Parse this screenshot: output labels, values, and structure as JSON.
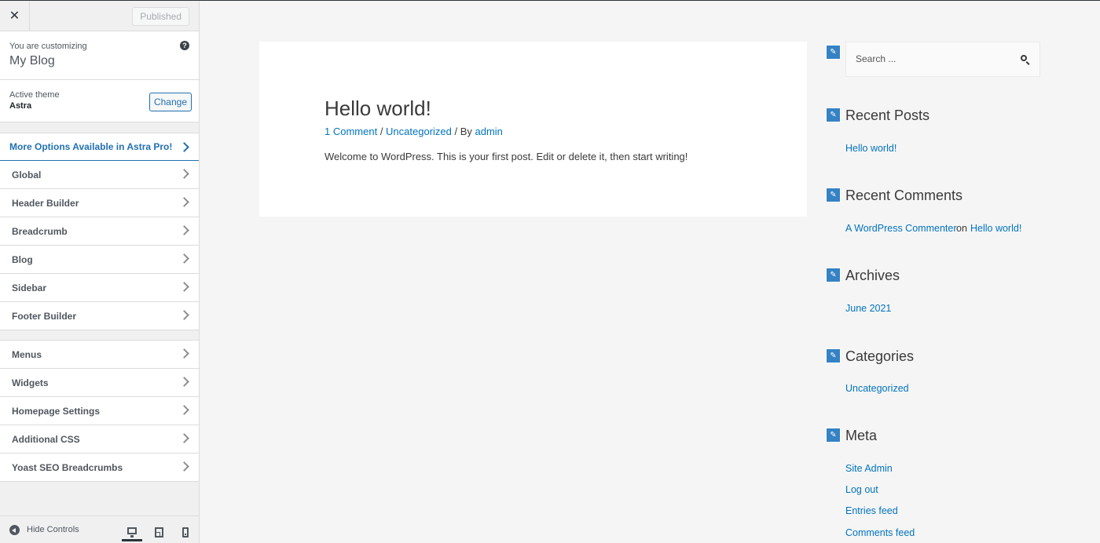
{
  "sidebar": {
    "close_icon": "close-icon",
    "publish_label": "Published",
    "customizing_label": "You are customizing",
    "site_title": "My Blog",
    "active_theme_label": "Active theme",
    "active_theme_name": "Astra",
    "change_label": "Change",
    "pro_label": "More Options Available in Astra Pro!",
    "group1": [
      {
        "label": "Global"
      },
      {
        "label": "Header Builder"
      },
      {
        "label": "Breadcrumb"
      },
      {
        "label": "Blog"
      },
      {
        "label": "Sidebar"
      },
      {
        "label": "Footer Builder"
      }
    ],
    "group2": [
      {
        "label": "Menus"
      },
      {
        "label": "Widgets"
      },
      {
        "label": "Homepage Settings"
      },
      {
        "label": "Additional CSS"
      },
      {
        "label": "Yoast SEO Breadcrumbs"
      }
    ],
    "hide_controls_label": "Hide Controls"
  },
  "preview": {
    "post": {
      "title": "Hello world!",
      "comments": "1 Comment",
      "sep1": " / ",
      "category": "Uncategorized",
      "sep2": " / By ",
      "author": "admin",
      "body": "Welcome to WordPress. This is your first post. Edit or delete it, then start writing!"
    },
    "search": {
      "placeholder": "Search ..."
    },
    "recent_posts": {
      "title": "Recent Posts",
      "items": [
        "Hello world!"
      ]
    },
    "recent_comments": {
      "title": "Recent Comments",
      "author": "A WordPress Commenter",
      "on": "on",
      "post": "Hello world!"
    },
    "archives": {
      "title": "Archives",
      "items": [
        "June 2021"
      ]
    },
    "categories": {
      "title": "Categories",
      "items": [
        "Uncategorized"
      ]
    },
    "meta": {
      "title": "Meta",
      "items": [
        "Site Admin",
        "Log out",
        "Entries feed",
        "Comments feed"
      ]
    }
  },
  "colors": {
    "accent": "#2271b1",
    "link": "#0274be",
    "edit_tag": "#3582c4"
  }
}
